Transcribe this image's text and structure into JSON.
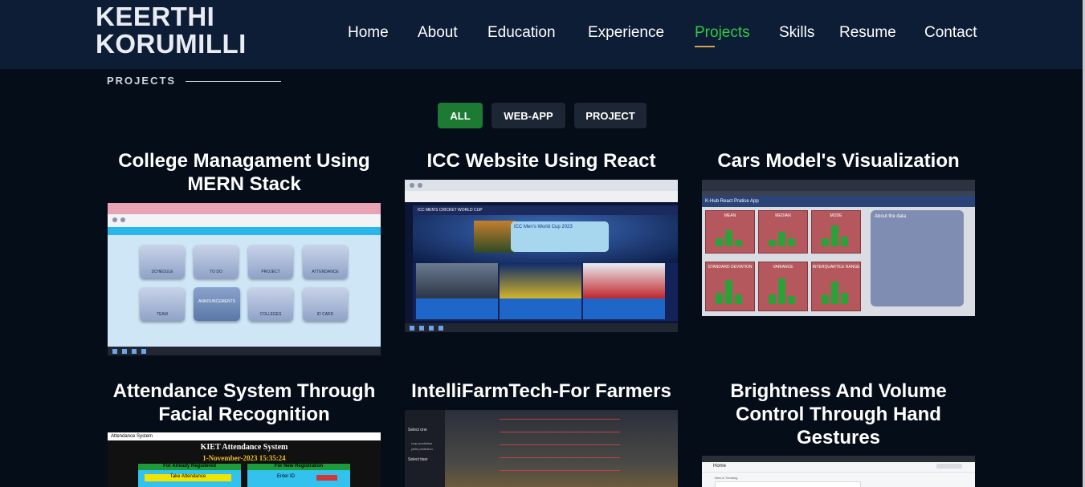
{
  "header": {
    "logo": "KEERTHI\nKORUMILLI",
    "nav": [
      {
        "label": "Home",
        "active": false
      },
      {
        "label": "About",
        "active": false
      },
      {
        "label": "Education",
        "active": false
      },
      {
        "label": "Experience",
        "active": false
      },
      {
        "label": "Projects",
        "active": true
      },
      {
        "label": "Skills",
        "active": false
      },
      {
        "label": "Resume",
        "active": false
      },
      {
        "label": "Contact",
        "active": false
      }
    ]
  },
  "section": {
    "label": "PROJECTS"
  },
  "filters": [
    {
      "label": "ALL",
      "active": true
    },
    {
      "label": "WEB-APP",
      "active": false
    },
    {
      "label": "PROJECT",
      "active": false
    }
  ],
  "projects": [
    {
      "title": "College Managament Using MERN Stack"
    },
    {
      "title": "ICC Website Using React"
    },
    {
      "title": "Cars Model's Visualization"
    },
    {
      "title": "Attendance System Through Facial Recognition"
    },
    {
      "title": "IntelliFarmTech-For Farmers"
    },
    {
      "title": "Brightness And Volume Control Through Hand Gestures"
    }
  ],
  "thumbs": {
    "college_tiles": [
      "SCHEDULE",
      "TO DO",
      "PROJECT",
      "ATTENDANCE",
      "TEAM",
      "ANNOUNCEMENTS",
      "COLLEGES",
      "ID CARD"
    ],
    "cars": {
      "app_title": "K-Hub React Pratice App",
      "stats": [
        "MEAN",
        "MEDIAN",
        "MODE",
        "STANDARD DEVIATION",
        "VARIANCE",
        "INTERQUARTILE RANGE"
      ],
      "about_title": "About the data"
    },
    "attendance": {
      "window_title": "Attendance System",
      "heading": "KIET Attendance System",
      "date": "1-November-2023  15:35:24",
      "left_panel": "For Already Registered",
      "left_button": "Take Attendance",
      "right_panel": "For New Registration",
      "right_field": "Enter ID"
    },
    "farm": {
      "select_one": "Select one",
      "options": [
        "crop prediction",
        "yield prediction"
      ],
      "select_two": "Select tiser"
    },
    "hand": {
      "home": "Home",
      "item": "New & Trending"
    },
    "icc": {
      "nav_title": "ICC MEN'S CRICKET WORLD CUP",
      "banner_title": "ICC Men's World Cup 2023"
    }
  }
}
